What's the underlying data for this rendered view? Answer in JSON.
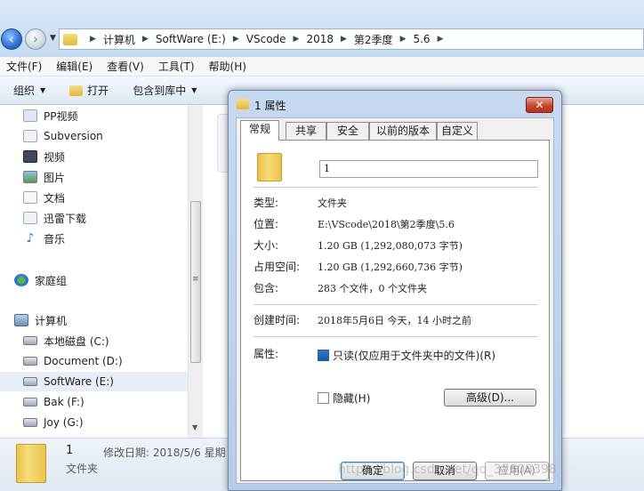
{
  "explorer": {
    "breadcrumbs": [
      "计算机",
      "SoftWare (E:)",
      "VScode",
      "2018",
      "第2季度",
      "5.6"
    ],
    "menu": [
      "文件(F)",
      "编辑(E)",
      "查看(V)",
      "工具(T)",
      "帮助(H)"
    ],
    "toolbar": {
      "organize": "组织",
      "open": "打开",
      "include": "包含到库中"
    },
    "nav": [
      {
        "label": "PP视频",
        "icon": "video-icon"
      },
      {
        "label": "Subversion",
        "icon": "document-icon"
      },
      {
        "label": "视频",
        "icon": "film-icon"
      },
      {
        "label": "图片",
        "icon": "picture-icon"
      },
      {
        "label": "文档",
        "icon": "document-icon"
      },
      {
        "label": "迅雷下载",
        "icon": "document-icon"
      },
      {
        "label": "音乐",
        "icon": "music-icon"
      },
      {
        "label": "家庭组",
        "icon": "homegroup-icon"
      },
      {
        "label": "计算机",
        "icon": "computer-icon"
      },
      {
        "label": "本地磁盘 (C:)",
        "icon": "drive-icon"
      },
      {
        "label": "Document (D:)",
        "icon": "drive-icon"
      },
      {
        "label": "SoftWare (E:)",
        "icon": "drive-icon"
      },
      {
        "label": "Bak (F:)",
        "icon": "drive-icon"
      },
      {
        "label": "Joy (G:)",
        "icon": "drive-icon"
      }
    ],
    "details": {
      "name": "1",
      "modified": "修改日期: 2018/5/6 星期",
      "type": "文件夹"
    }
  },
  "dialog": {
    "title": "1 属性",
    "close": "✕",
    "tabs": [
      "常规",
      "共享",
      "安全",
      "以前的版本",
      "自定义"
    ],
    "name_value": "1",
    "type_label": "类型:",
    "type_value": "文件夹",
    "location_label": "位置:",
    "location_value": "E:\\VScode\\2018\\第2季度\\5.6",
    "size_label": "大小:",
    "size_value": "1.20 GB (1,292,080,073 字节)",
    "disk_size_label": "占用空间:",
    "disk_size_value": "1.20 GB (1,292,660,736 字节)",
    "contains_label": "包含:",
    "contains_value": "283 个文件，0 个文件夹",
    "created_label": "创建时间:",
    "created_value": "2018年5月6日 今天，14 小时之前",
    "attributes_label": "属性:",
    "readonly_label": "只读(仅应用于文件夹中的文件)(R)",
    "hidden_label": "隐藏(H)",
    "advanced_button": "高级(D)...",
    "ok": "确定",
    "cancel": "取消",
    "apply": "应用(A)"
  },
  "watermark": "https://blog.csdn.net/qq_37608398",
  "colors": {
    "close_red": "#c8442c",
    "titlebar": "#c7d9ef",
    "checkbox_checked": "#2e76c8"
  }
}
